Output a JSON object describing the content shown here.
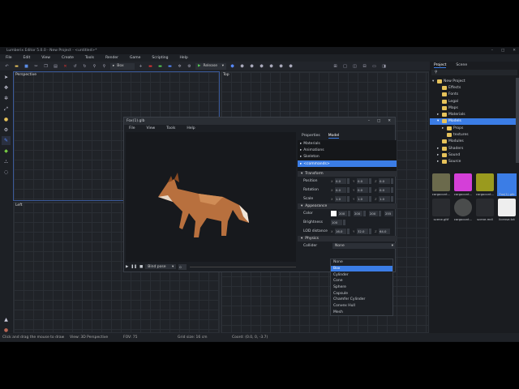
{
  "window": {
    "title": "Lumberix Editor 5.0.0 - New Project - <untitled>*",
    "min": "–",
    "max": "□",
    "close": "✕"
  },
  "menu": [
    "File",
    "Edit",
    "View",
    "Create",
    "Tools",
    "Render",
    "Game",
    "Scripting",
    "Help"
  ],
  "toolbar": {
    "mode_select": "Box",
    "render_select": "Release"
  },
  "viewports": {
    "perspective": "Perspective",
    "top": "Top",
    "left": "Left"
  },
  "right_panel": {
    "tabs": [
      "Project",
      "Scene"
    ],
    "active_tab": "Project",
    "search_value": "",
    "tree": [
      {
        "label": "New Project",
        "level": 0,
        "arrow": "▾"
      },
      {
        "label": "Effects",
        "level": 1,
        "arrow": ""
      },
      {
        "label": "Fonts",
        "level": 1,
        "arrow": ""
      },
      {
        "label": "Legal",
        "level": 1,
        "arrow": ""
      },
      {
        "label": "Maps",
        "level": 1,
        "arrow": ""
      },
      {
        "label": "Materials",
        "level": 1,
        "arrow": "▸"
      },
      {
        "label": "Models",
        "level": 1,
        "arrow": "▾",
        "selected": true
      },
      {
        "label": "Props",
        "level": 2,
        "arrow": "▸"
      },
      {
        "label": "textures",
        "level": 2,
        "arrow": ""
      },
      {
        "label": "Modules",
        "level": 1,
        "arrow": ""
      },
      {
        "label": "Shaders",
        "level": 1,
        "arrow": "▸"
      },
      {
        "label": "Sound",
        "level": 1,
        "arrow": "▸"
      },
      {
        "label": "Source",
        "level": 1,
        "arrow": "▸"
      }
    ],
    "assets": [
      {
        "label": "cargocont...",
        "color": "#6b6a4c"
      },
      {
        "label": "cargocont...",
        "color": "#d43fd8"
      },
      {
        "label": "cargocont...",
        "color": "#9a9a1e"
      },
      {
        "label": "Fox(1).glb",
        "color": "#3b7de6",
        "selected": true
      },
      {
        "label": "scene.gltf",
        "color": "#2a2c30"
      },
      {
        "label": "cargocont...",
        "color": "#4a4c4c"
      },
      {
        "label": "scene.mdl",
        "color": "#2a2c30"
      },
      {
        "label": "license.txt",
        "color": "#eeeeee"
      }
    ]
  },
  "dialog": {
    "title": "Fox(1).glb",
    "menu": [
      "File",
      "View",
      "Tools",
      "Help"
    ],
    "tabs": [
      "Properties",
      "Model"
    ],
    "active_tab": "Model",
    "tree": [
      "Materials",
      "Animations",
      "Skeleton",
      "<commands>"
    ],
    "transform": {
      "title": "Transform",
      "rows": [
        {
          "label": "Position",
          "values": [
            "0.0",
            "0.0",
            "0.0"
          ]
        },
        {
          "label": "Rotation",
          "values": [
            "0.0",
            "0.0",
            "0.0"
          ]
        },
        {
          "label": "Scale",
          "values": [
            "1.0",
            "1.0",
            "1.0"
          ]
        }
      ]
    },
    "appearance": {
      "title": "Appearance",
      "color_label": "Color",
      "color_values": [
        "200",
        "200",
        "200",
        "255"
      ],
      "brightness_label": "Brightness",
      "brightness": "100",
      "lod_label": "LOD distance",
      "lod": [
        "16.0",
        "32.0",
        "64.0"
      ]
    },
    "physics": {
      "title": "Physics",
      "collider_label": "Collider",
      "collider_value": "None"
    },
    "anim_select": "Bind pose",
    "frame": "0"
  },
  "collider_options": [
    "None",
    "Box",
    "Cylinder",
    "Cone",
    "Sphere",
    "Capsule",
    "Chamfer Cylinder",
    "Convex Hull",
    "Mesh"
  ],
  "collider_highlight": "Box",
  "status": {
    "hint": "Click and drag the mouse to draw",
    "view": "View: 3D Perspective",
    "fov": "FOV: 75",
    "grid": "Grid size: 16 cm",
    "coord": "Coord: (0.0, 0, -3.7)"
  },
  "colors": {
    "accent": "#3b7de6"
  }
}
